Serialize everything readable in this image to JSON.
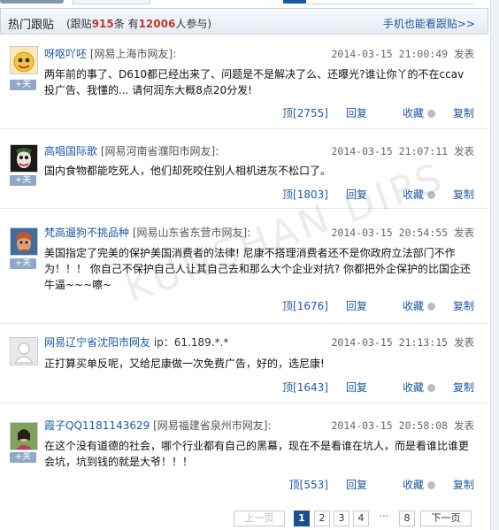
{
  "header": {
    "title": "热门跟贴",
    "stats_prefix": "(跟贴",
    "post_count": "915",
    "stats_mid": "条 有",
    "user_count": "12006",
    "stats_suffix": "人参与)",
    "mobile_link": "手机也能看跟贴>>"
  },
  "follow_label": "+关",
  "actions": {
    "reply": "回复",
    "favorite": "收藏",
    "copy": "复制",
    "publish": "发表"
  },
  "posts": [
    {
      "user": "呀呕吖呸",
      "location": "[网易上海市网友]:",
      "time": "2014-03-15 21:00:49",
      "content": "两年前的事了、D610都已经出来了、问题是不是解决了么、还曝光?谁让你丫的不在ccav投广告、我懂的... 请何润东大概8点20分发!",
      "upvotes": "顶[2755]"
    },
    {
      "user": "高唱国际歌",
      "location": "[网易河南省濮阳市网友]:",
      "time": "2014-03-15 21:07:11",
      "content": "国内食物都能吃死人，他们却死咬住别人相机进灰不松口了。",
      "upvotes": "顶[1803]"
    },
    {
      "user": "梵高遛狗不挑品种",
      "location": "[网易山东省东营市网友]:",
      "time": "2014-03-15 20:54:55",
      "content": "美国指定了完美的保护美国消费者的法律! 尼康不搭理消费者还不是你政府立法部门不作为！！！ 你自己不保护自己人让其自己去和那么大个企业对抗? 你都把外企保护的比国企还牛逼~~~嚓~",
      "upvotes": "顶[1676]"
    },
    {
      "user": "网易辽宁省沈阳市网友",
      "location": "ip：61.189.*.*",
      "time": "2014-03-15 21:13:15",
      "content": "正打算买单反呢，又给尼康做一次免费广告，好的，选尼康!",
      "upvotes": "顶[1643]"
    },
    {
      "user": "霞子QQ1181143629",
      "location": "[网易福建省泉州市网友]:",
      "time": "2014-03-15 20:58:08",
      "content": "在这个没有道德的社会，哪个行业都有自己的黑幕，现在不是看谁在坑人，而是看谁比谁更会坑，坑到钱的就是大爷！！！",
      "upvotes": "顶[553]"
    }
  ],
  "pager": {
    "prev": "上一页",
    "pages": [
      "1",
      "2",
      "3",
      "4"
    ],
    "ellipsis": "···",
    "last": "8",
    "next": "下一页"
  },
  "watermark": "KUNSHAN DIPS",
  "colors": {
    "link": "#1c5aa5",
    "accent_number": "#c0392b",
    "current_page": "#1b4f8f"
  }
}
